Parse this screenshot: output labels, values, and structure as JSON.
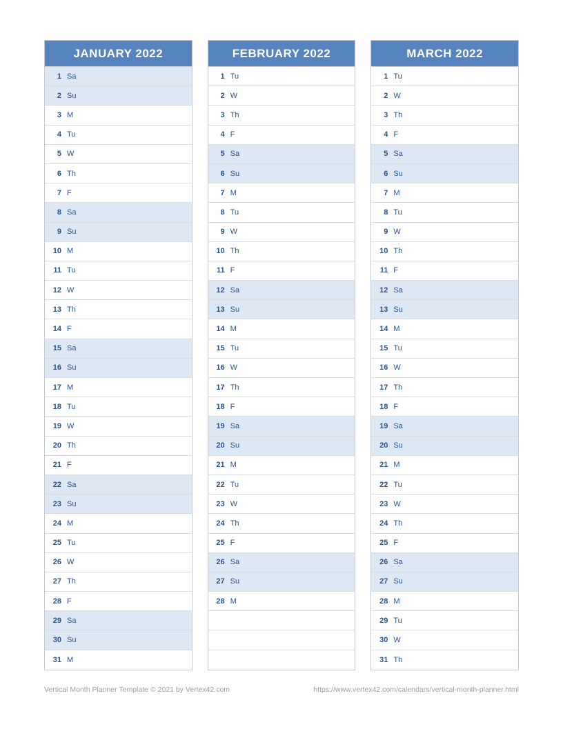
{
  "months": [
    {
      "title": "JANUARY 2022",
      "days": [
        {
          "num": "1",
          "lbl": "Sa",
          "weekend": true
        },
        {
          "num": "2",
          "lbl": "Su",
          "weekend": true
        },
        {
          "num": "3",
          "lbl": "M",
          "weekend": false
        },
        {
          "num": "4",
          "lbl": "Tu",
          "weekend": false
        },
        {
          "num": "5",
          "lbl": "W",
          "weekend": false
        },
        {
          "num": "6",
          "lbl": "Th",
          "weekend": false
        },
        {
          "num": "7",
          "lbl": "F",
          "weekend": false
        },
        {
          "num": "8",
          "lbl": "Sa",
          "weekend": true
        },
        {
          "num": "9",
          "lbl": "Su",
          "weekend": true
        },
        {
          "num": "10",
          "lbl": "M",
          "weekend": false
        },
        {
          "num": "11",
          "lbl": "Tu",
          "weekend": false
        },
        {
          "num": "12",
          "lbl": "W",
          "weekend": false
        },
        {
          "num": "13",
          "lbl": "Th",
          "weekend": false
        },
        {
          "num": "14",
          "lbl": "F",
          "weekend": false
        },
        {
          "num": "15",
          "lbl": "Sa",
          "weekend": true
        },
        {
          "num": "16",
          "lbl": "Su",
          "weekend": true
        },
        {
          "num": "17",
          "lbl": "M",
          "weekend": false
        },
        {
          "num": "18",
          "lbl": "Tu",
          "weekend": false
        },
        {
          "num": "19",
          "lbl": "W",
          "weekend": false
        },
        {
          "num": "20",
          "lbl": "Th",
          "weekend": false
        },
        {
          "num": "21",
          "lbl": "F",
          "weekend": false
        },
        {
          "num": "22",
          "lbl": "Sa",
          "weekend": true
        },
        {
          "num": "23",
          "lbl": "Su",
          "weekend": true
        },
        {
          "num": "24",
          "lbl": "M",
          "weekend": false
        },
        {
          "num": "25",
          "lbl": "Tu",
          "weekend": false
        },
        {
          "num": "26",
          "lbl": "W",
          "weekend": false
        },
        {
          "num": "27",
          "lbl": "Th",
          "weekend": false
        },
        {
          "num": "28",
          "lbl": "F",
          "weekend": false
        },
        {
          "num": "29",
          "lbl": "Sa",
          "weekend": true
        },
        {
          "num": "30",
          "lbl": "Su",
          "weekend": true
        },
        {
          "num": "31",
          "lbl": "M",
          "weekend": false
        }
      ]
    },
    {
      "title": "FEBRUARY 2022",
      "days": [
        {
          "num": "1",
          "lbl": "Tu",
          "weekend": false
        },
        {
          "num": "2",
          "lbl": "W",
          "weekend": false
        },
        {
          "num": "3",
          "lbl": "Th",
          "weekend": false
        },
        {
          "num": "4",
          "lbl": "F",
          "weekend": false
        },
        {
          "num": "5",
          "lbl": "Sa",
          "weekend": true
        },
        {
          "num": "6",
          "lbl": "Su",
          "weekend": true
        },
        {
          "num": "7",
          "lbl": "M",
          "weekend": false
        },
        {
          "num": "8",
          "lbl": "Tu",
          "weekend": false
        },
        {
          "num": "9",
          "lbl": "W",
          "weekend": false
        },
        {
          "num": "10",
          "lbl": "Th",
          "weekend": false
        },
        {
          "num": "11",
          "lbl": "F",
          "weekend": false
        },
        {
          "num": "12",
          "lbl": "Sa",
          "weekend": true
        },
        {
          "num": "13",
          "lbl": "Su",
          "weekend": true
        },
        {
          "num": "14",
          "lbl": "M",
          "weekend": false
        },
        {
          "num": "15",
          "lbl": "Tu",
          "weekend": false
        },
        {
          "num": "16",
          "lbl": "W",
          "weekend": false
        },
        {
          "num": "17",
          "lbl": "Th",
          "weekend": false
        },
        {
          "num": "18",
          "lbl": "F",
          "weekend": false
        },
        {
          "num": "19",
          "lbl": "Sa",
          "weekend": true
        },
        {
          "num": "20",
          "lbl": "Su",
          "weekend": true
        },
        {
          "num": "21",
          "lbl": "M",
          "weekend": false
        },
        {
          "num": "22",
          "lbl": "Tu",
          "weekend": false
        },
        {
          "num": "23",
          "lbl": "W",
          "weekend": false
        },
        {
          "num": "24",
          "lbl": "Th",
          "weekend": false
        },
        {
          "num": "25",
          "lbl": "F",
          "weekend": false
        },
        {
          "num": "26",
          "lbl": "Sa",
          "weekend": true
        },
        {
          "num": "27",
          "lbl": "Su",
          "weekend": true
        },
        {
          "num": "28",
          "lbl": "M",
          "weekend": false
        },
        {
          "num": "",
          "lbl": "",
          "weekend": false
        },
        {
          "num": "",
          "lbl": "",
          "weekend": false
        },
        {
          "num": "",
          "lbl": "",
          "weekend": false
        }
      ]
    },
    {
      "title": "MARCH 2022",
      "days": [
        {
          "num": "1",
          "lbl": "Tu",
          "weekend": false
        },
        {
          "num": "2",
          "lbl": "W",
          "weekend": false
        },
        {
          "num": "3",
          "lbl": "Th",
          "weekend": false
        },
        {
          "num": "4",
          "lbl": "F",
          "weekend": false
        },
        {
          "num": "5",
          "lbl": "Sa",
          "weekend": true
        },
        {
          "num": "6",
          "lbl": "Su",
          "weekend": true
        },
        {
          "num": "7",
          "lbl": "M",
          "weekend": false
        },
        {
          "num": "8",
          "lbl": "Tu",
          "weekend": false
        },
        {
          "num": "9",
          "lbl": "W",
          "weekend": false
        },
        {
          "num": "10",
          "lbl": "Th",
          "weekend": false
        },
        {
          "num": "11",
          "lbl": "F",
          "weekend": false
        },
        {
          "num": "12",
          "lbl": "Sa",
          "weekend": true
        },
        {
          "num": "13",
          "lbl": "Su",
          "weekend": true
        },
        {
          "num": "14",
          "lbl": "M",
          "weekend": false
        },
        {
          "num": "15",
          "lbl": "Tu",
          "weekend": false
        },
        {
          "num": "16",
          "lbl": "W",
          "weekend": false
        },
        {
          "num": "17",
          "lbl": "Th",
          "weekend": false
        },
        {
          "num": "18",
          "lbl": "F",
          "weekend": false
        },
        {
          "num": "19",
          "lbl": "Sa",
          "weekend": true
        },
        {
          "num": "20",
          "lbl": "Su",
          "weekend": true
        },
        {
          "num": "21",
          "lbl": "M",
          "weekend": false
        },
        {
          "num": "22",
          "lbl": "Tu",
          "weekend": false
        },
        {
          "num": "23",
          "lbl": "W",
          "weekend": false
        },
        {
          "num": "24",
          "lbl": "Th",
          "weekend": false
        },
        {
          "num": "25",
          "lbl": "F",
          "weekend": false
        },
        {
          "num": "26",
          "lbl": "Sa",
          "weekend": true
        },
        {
          "num": "27",
          "lbl": "Su",
          "weekend": true
        },
        {
          "num": "28",
          "lbl": "M",
          "weekend": false
        },
        {
          "num": "29",
          "lbl": "Tu",
          "weekend": false
        },
        {
          "num": "30",
          "lbl": "W",
          "weekend": false
        },
        {
          "num": "31",
          "lbl": "Th",
          "weekend": false
        }
      ]
    }
  ],
  "footer_left": "Vertical Month Planner Template © 2021 by Vertex42.com",
  "footer_right": "https://www.vertex42.com/calendars/vertical-month-planner.html"
}
